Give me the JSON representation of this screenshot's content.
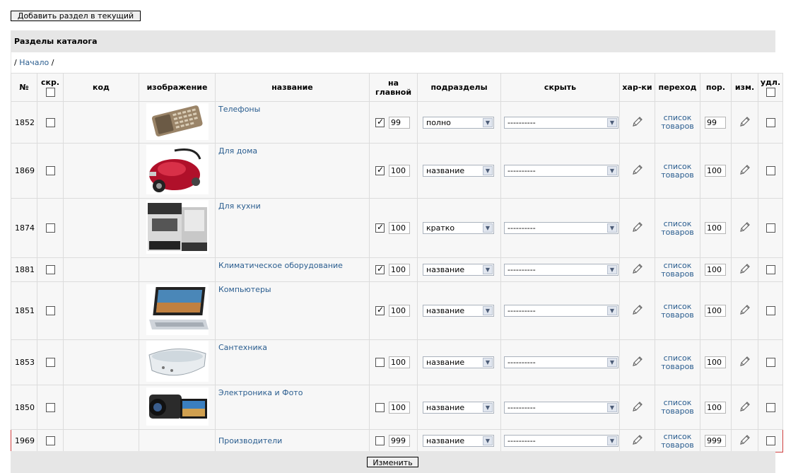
{
  "top_button": "Добавить раздел в текущий",
  "panel_title": "Разделы каталога",
  "breadcrumb": {
    "sep1": "/",
    "home": "Начало",
    "sep2": "/"
  },
  "headers": {
    "num": "№",
    "hidden": "скр.",
    "code": "код",
    "image": "изображение",
    "name": "название",
    "on_main_1": "на",
    "on_main_2": "главной",
    "subsections": "подразделы",
    "hide": "скрыть",
    "props": "хар-ки",
    "goto": "переход",
    "order": "пор.",
    "edit": "изм.",
    "delete": "удл."
  },
  "rows": [
    {
      "id": "1852",
      "name": "Телефоны",
      "on_main": true,
      "main_order": "99",
      "sub": "полно",
      "hide": "----------",
      "goto_1": "список",
      "goto_2": "товаров",
      "order": "99",
      "image": "phone"
    },
    {
      "id": "1869",
      "name": "Для дома",
      "on_main": true,
      "main_order": "100",
      "sub": "название",
      "hide": "----------",
      "goto_1": "список",
      "goto_2": "товаров",
      "order": "100",
      "image": "vacuum"
    },
    {
      "id": "1874",
      "name": "Для кухни",
      "on_main": true,
      "main_order": "100",
      "sub": "кратко",
      "hide": "----------",
      "goto_1": "список",
      "goto_2": "товаров",
      "order": "100",
      "image": "coffee-machine"
    },
    {
      "id": "1881",
      "name": "Климатическое оборудование",
      "on_main": true,
      "main_order": "100",
      "sub": "название",
      "hide": "----------",
      "goto_1": "список",
      "goto_2": "товаров",
      "order": "100",
      "image": ""
    },
    {
      "id": "1851",
      "name": "Компьютеры",
      "on_main": true,
      "main_order": "100",
      "sub": "название",
      "hide": "----------",
      "goto_1": "список",
      "goto_2": "товаров",
      "order": "100",
      "image": "laptop"
    },
    {
      "id": "1853",
      "name": "Сантехника",
      "on_main": false,
      "main_order": "100",
      "sub": "название",
      "hide": "----------",
      "goto_1": "список",
      "goto_2": "товаров",
      "order": "100",
      "image": "bathtub"
    },
    {
      "id": "1850",
      "name": "Электроника и Фото",
      "on_main": false,
      "main_order": "100",
      "sub": "название",
      "hide": "----------",
      "goto_1": "список",
      "goto_2": "товаров",
      "order": "100",
      "image": "camcorder"
    },
    {
      "id": "1969",
      "name": "Производители",
      "on_main": false,
      "main_order": "999",
      "sub": "название",
      "hide": "----------",
      "goto_1": "список",
      "goto_2": "товаров",
      "order": "999",
      "image": ""
    }
  ],
  "save_button": "Изменить",
  "colors": {
    "link": "#2a5d8f",
    "header_bg": "#e6e6e6",
    "row_bg": "#f7f7f7",
    "highlight": "#d04040"
  }
}
